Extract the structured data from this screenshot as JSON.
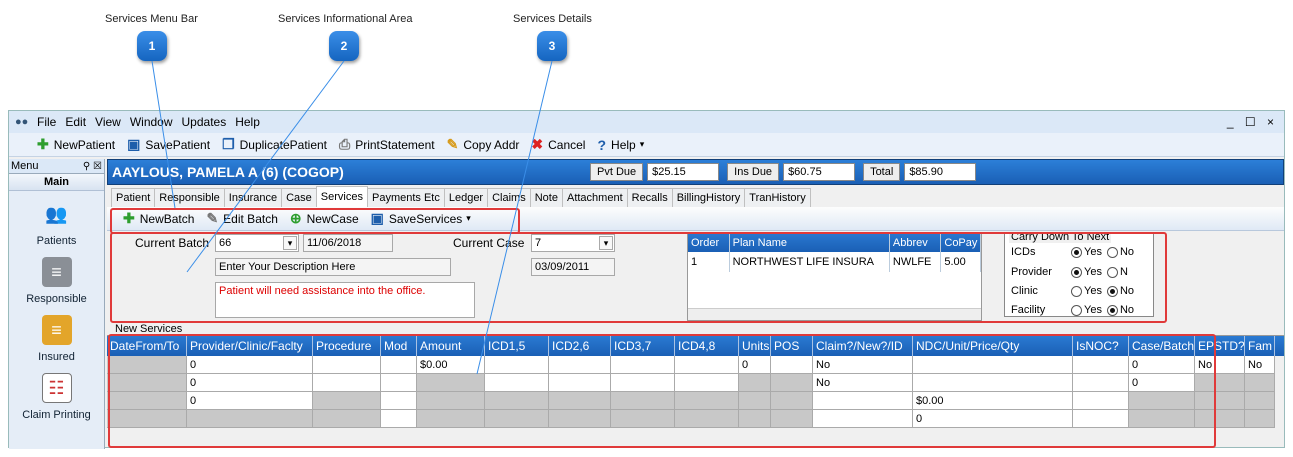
{
  "callouts": [
    {
      "num": "1",
      "label": "Services Menu Bar"
    },
    {
      "num": "2",
      "label": "Services Informational Area"
    },
    {
      "num": "3",
      "label": "Services Details"
    }
  ],
  "menubar": {
    "items": [
      "File",
      "Edit",
      "View",
      "Window",
      "Updates",
      "Help"
    ],
    "window_controls": "_ ☐ ×"
  },
  "toolbar": {
    "new_patient": "NewPatient",
    "save_patient": "SavePatient",
    "duplicate_patient": "DuplicatePatient",
    "print_statement": "PrintStatement",
    "copy_addr": "Copy Addr",
    "cancel": "Cancel",
    "help": "Help"
  },
  "left_panel": {
    "title": "Menu",
    "section": "Main",
    "items": [
      "Patients",
      "Responsible",
      "Insured",
      "Claim Printing"
    ]
  },
  "patient": {
    "name": "AAYLOUS, PAMELA A (6) (COGOP)",
    "pvt_due_label": "Pvt Due",
    "pvt_due": "$25.15",
    "ins_due_label": "Ins Due",
    "ins_due": "$60.75",
    "total_label": "Total",
    "total": "$85.90"
  },
  "tabs": [
    "Patient",
    "Responsible",
    "Insurance",
    "Case",
    "Services",
    "Payments Etc",
    "Ledger",
    "Claims",
    "Note",
    "Attachment",
    "Recalls",
    "BillingHistory",
    "TranHistory"
  ],
  "active_tab": "Services",
  "services_toolbar": {
    "new_batch": "NewBatch",
    "edit_batch": "Edit Batch",
    "new_case": "NewCase",
    "save_services": "SaveServices"
  },
  "info": {
    "current_batch_label": "Current Batch",
    "current_batch": "66",
    "batch_date": "11/06/2018",
    "description": "Enter Your Description Here",
    "note": "Patient will need assistance into the office.",
    "current_case_label": "Current Case",
    "current_case": "7",
    "case_date": "03/09/2011"
  },
  "plan_grid": {
    "headers": [
      "Order",
      "Plan Name",
      "Abbrev",
      "CoPay"
    ],
    "rows": [
      [
        "1",
        "NORTHWEST LIFE INSURA",
        "NWLFE",
        "5.00"
      ]
    ]
  },
  "carry_down": {
    "title": "Carry Down To Next",
    "rows": [
      {
        "label": "ICDs",
        "yes": "Yes",
        "no": "No",
        "selected": "yes"
      },
      {
        "label": "Provider",
        "yes": "Yes",
        "no": "N",
        "selected": "yes"
      },
      {
        "label": "Clinic",
        "yes": "Yes",
        "no": "No",
        "selected": "no"
      },
      {
        "label": "Facility",
        "yes": "Yes",
        "no": "No",
        "selected": "no"
      }
    ]
  },
  "new_services": {
    "label": "New Services",
    "headers": [
      "DateFrom/To",
      "Provider/Clinic/Faclty",
      "Procedure",
      "Mod",
      "Amount",
      "ICD1,5",
      "ICD2,6",
      "ICD3,7",
      "ICD4,8",
      "Units",
      "POS",
      "Claim?/New?/ID",
      "NDC/Unit/Price/Qty",
      "IsNOC?",
      "Case/Batch",
      "EPSTD?",
      "Fam"
    ],
    "rows": [
      [
        "",
        "0",
        "",
        "",
        "$0.00",
        "",
        "",
        "",
        "",
        "0",
        "",
        "No",
        "",
        "",
        "0",
        "No",
        "No"
      ],
      [
        "",
        "0",
        "",
        "",
        "",
        "",
        "",
        "",
        "",
        "",
        "",
        "No",
        "",
        "",
        "0",
        "",
        ""
      ],
      [
        "",
        "0",
        "",
        "",
        "",
        "",
        "",
        "",
        "",
        "",
        "",
        "",
        "$0.00",
        "",
        "",
        "",
        ""
      ],
      [
        "",
        "",
        "",
        "",
        "",
        "",
        "",
        "",
        "",
        "",
        "",
        "",
        "0",
        "",
        "",
        "",
        ""
      ]
    ]
  }
}
